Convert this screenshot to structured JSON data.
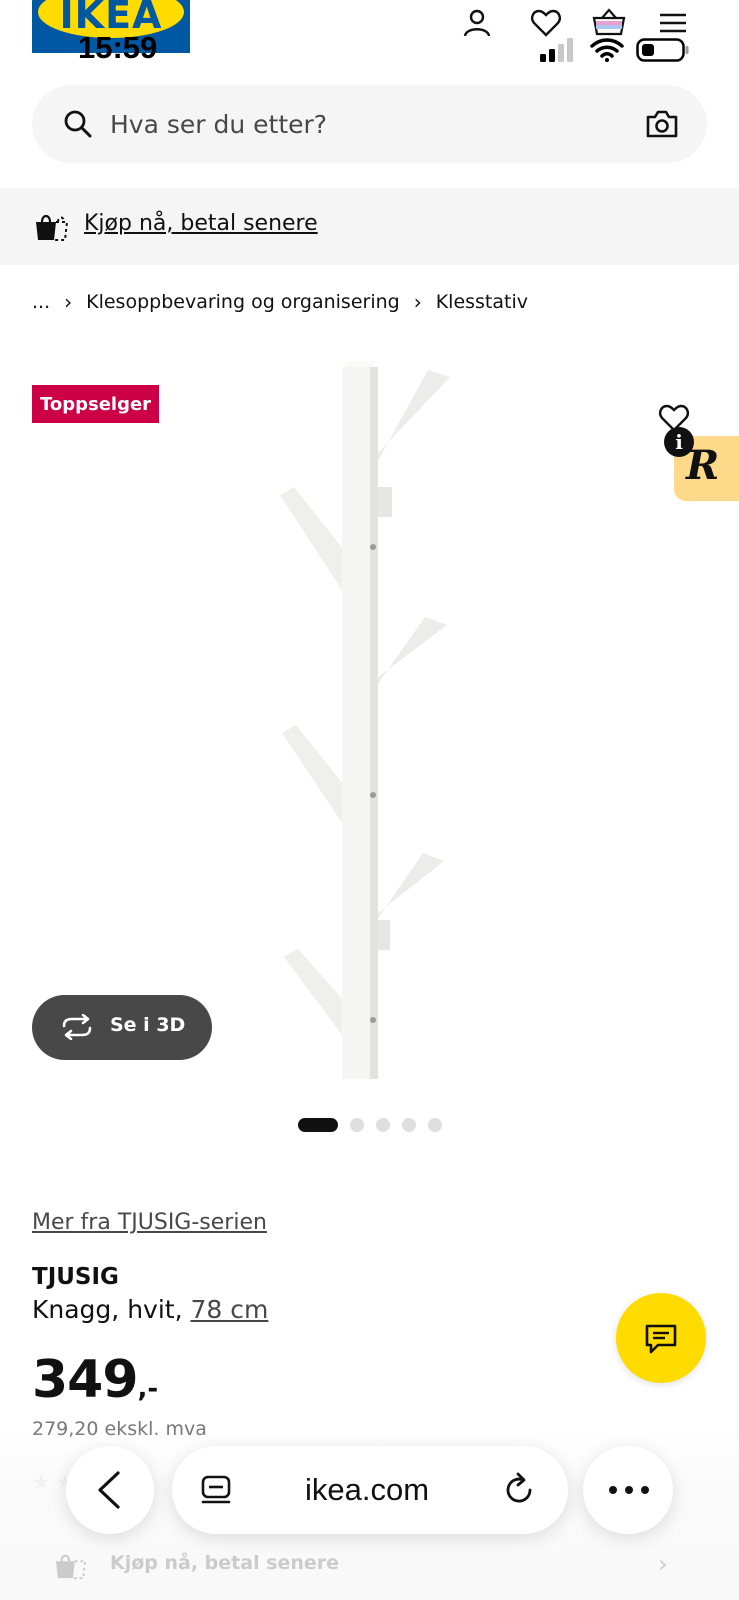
{
  "header": {
    "logo_text": "IKEA",
    "status_time": "15:59",
    "icons": [
      "profile-icon",
      "heart-icon",
      "basket-icon",
      "menu-icon"
    ]
  },
  "search": {
    "placeholder": "Hva ser du etter?"
  },
  "bnpl": {
    "label": "Kjøp nå, betal senere"
  },
  "breadcrumb": {
    "ellipsis": "...",
    "sep": "›",
    "level1": "Klesoppbevaring og organisering",
    "level2": "Klesstativ"
  },
  "product": {
    "badge": "Toppselger",
    "view_3d": "Se i 3D",
    "carousel": {
      "count": 5,
      "active": 0
    },
    "series_link": "Mer fra TJUSIG-serien",
    "name": "TJUSIG",
    "desc_prefix": "Knagg, hvit, ",
    "size": "78 cm",
    "price_main": "349",
    "price_suffix": ",-",
    "price_ex_vat": "279,20 ekskl. mva",
    "stars": "★★★★★"
  },
  "extension": {
    "info": "i",
    "badge": "R"
  },
  "bottom_bar": {
    "url": "ikea.com",
    "bnpl_label": "Kjøp nå, betal senere",
    "chevron": "›"
  },
  "colors": {
    "ikea_blue": "#0058a3",
    "ikea_yellow": "#ffdb00",
    "badge_red": "#cc0045"
  }
}
